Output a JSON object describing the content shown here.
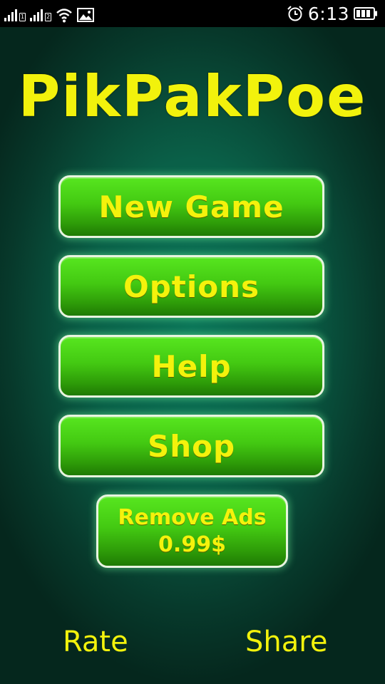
{
  "status_bar": {
    "time": "6:13",
    "sim1_label": "1",
    "sim2_label": "2",
    "icons": [
      "signal-sim1-icon",
      "signal-sim2-icon",
      "wifi-icon",
      "image-notification-icon",
      "alarm-icon",
      "battery-icon"
    ]
  },
  "game": {
    "title": "PikPakPoe",
    "menu": {
      "new_game": "New Game",
      "options": "Options",
      "help": "Help",
      "shop": "Shop",
      "remove_ads_line1": "Remove Ads",
      "remove_ads_line2": "0.99$"
    },
    "footer": {
      "rate": "Rate",
      "share": "Share"
    }
  },
  "colors": {
    "title_yellow": "#f2f20c",
    "button_green": "#43c912",
    "background_teal": "#0a6048"
  }
}
